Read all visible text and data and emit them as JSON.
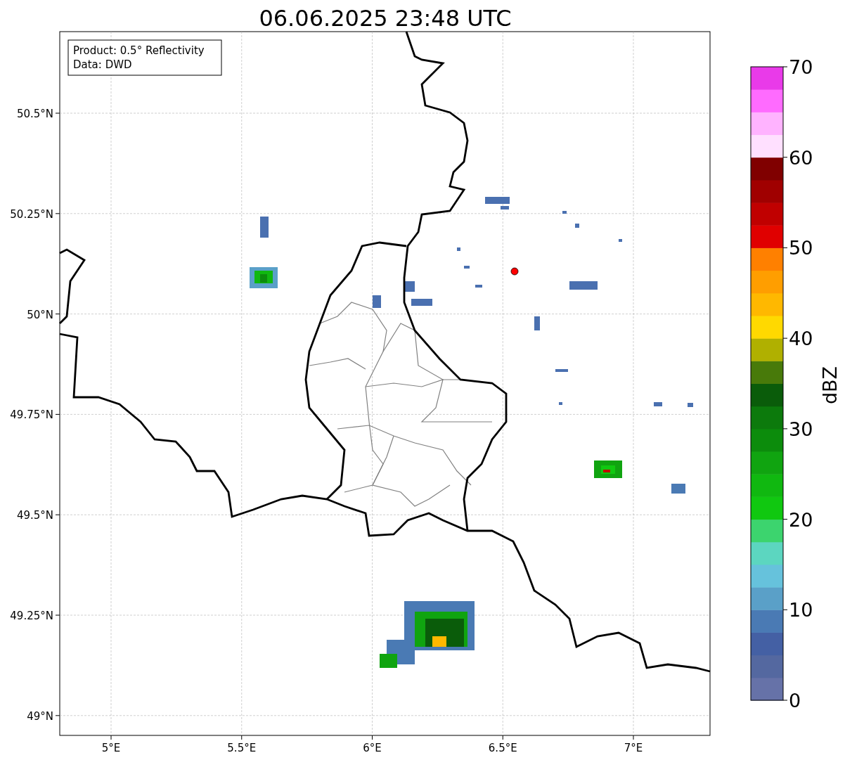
{
  "title": "06.06.2025 23:48 UTC",
  "legend": [
    "Product: 0.5° Reflectivity",
    "Data: DWD"
  ],
  "y_ticks": [
    "50.5°N",
    "50.25°N",
    "50°N",
    "49.75°N",
    "49.5°N",
    "49.25°N",
    "49°N"
  ],
  "x_ticks": [
    "5°E",
    "5.5°E",
    "6°E",
    "6.5°E",
    "7°E"
  ],
  "colorbar": {
    "label": "dBZ",
    "ticks": [
      "70",
      "60",
      "50",
      "40",
      "30",
      "20",
      "10",
      "0"
    ],
    "segments": [
      {
        "color": "#6672a8"
      },
      {
        "color": "#5468a0"
      },
      {
        "color": "#4460a4"
      },
      {
        "color": "#4a7ab4"
      },
      {
        "color": "#5aa0c8"
      },
      {
        "color": "#66c2dc"
      },
      {
        "color": "#5cd6c0"
      },
      {
        "color": "#3cd46e"
      },
      {
        "color": "#10c810"
      },
      {
        "color": "#10b810"
      },
      {
        "color": "#10a410"
      },
      {
        "color": "#0c8c0c"
      },
      {
        "color": "#0c7a0c"
      },
      {
        "color": "#0a5c0a"
      },
      {
        "color": "#487a0a"
      },
      {
        "color": "#b0b000"
      },
      {
        "color": "#ffd900"
      },
      {
        "color": "#ffb800"
      },
      {
        "color": "#ff9e00"
      },
      {
        "color": "#ff8000"
      },
      {
        "color": "#e00000"
      },
      {
        "color": "#c00000"
      },
      {
        "color": "#a00000"
      },
      {
        "color": "#800000"
      },
      {
        "color": "#ffe0ff"
      },
      {
        "color": "#ffb3ff"
      },
      {
        "color": "#ff6bff"
      },
      {
        "color": "#e93ae9"
      }
    ]
  }
}
